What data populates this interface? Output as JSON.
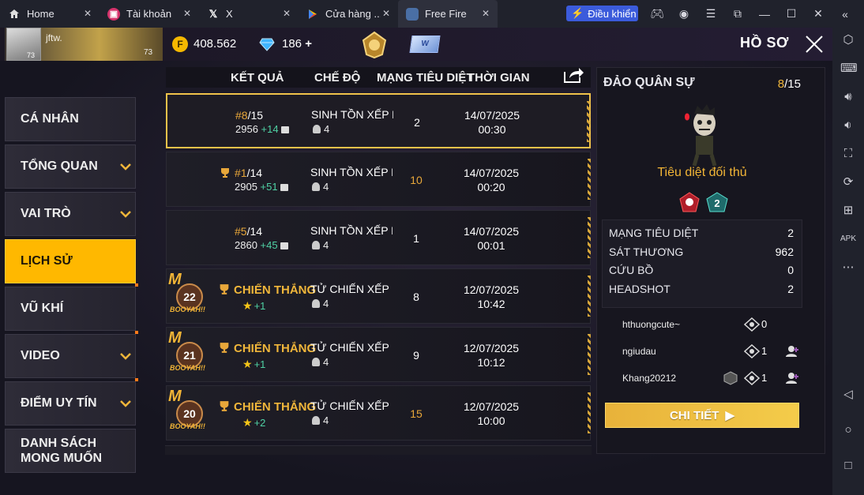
{
  "tabs": [
    {
      "label": "Home",
      "icon": "home-icon"
    },
    {
      "label": "Tài khoản",
      "icon": "app-icon"
    },
    {
      "label": "X",
      "icon": "x-logo-icon"
    },
    {
      "label": "Cửa hàng ...",
      "icon": "play-store-icon"
    },
    {
      "label": "Free Fire",
      "icon": "free-fire-icon"
    }
  ],
  "control_button": "Điều khiển",
  "topbar": {
    "player_name": "jftw.",
    "level_small": "73",
    "level": "73",
    "coins": "408.562",
    "coin_symbol": "F",
    "diamonds": "186",
    "diamonds_plus": "+",
    "card_label": "W",
    "title": "HỒ SƠ"
  },
  "menu": [
    {
      "label": "CÁ NHÂN",
      "chevron": false,
      "active": false
    },
    {
      "label": "TỔNG QUAN",
      "chevron": true,
      "active": false
    },
    {
      "label": "VAI TRÒ",
      "chevron": true,
      "active": false
    },
    {
      "label": "LỊCH SỬ",
      "chevron": false,
      "active": true
    },
    {
      "label": "VŨ KHÍ",
      "chevron": false,
      "active": false
    },
    {
      "label": "VIDEO",
      "chevron": true,
      "active": false
    },
    {
      "label": "ĐIỂM UY TÍN",
      "chevron": true,
      "active": false
    },
    {
      "label": "DANH SÁCH\nMONG MUỐN",
      "chevron": false,
      "active": false
    }
  ],
  "table": {
    "headers": {
      "result": "KẾT QUẢ",
      "mode": "CHẾ ĐỘ",
      "kills": "MẠNG TIÊU DIỆT",
      "time": "THỜI GIAN"
    },
    "rows": [
      {
        "rank": "#8",
        "total": "/15",
        "points": "2956",
        "gain": "+14",
        "mode": "SINH TỒN XẾP HẠ",
        "party": "4",
        "kills": "2",
        "date": "14/07/2025",
        "time": "00:30"
      },
      {
        "rank": "#1",
        "total": "/14",
        "points": "2905",
        "gain": "+51",
        "mode": "SINH TỒN XẾP HẠ",
        "party": "4",
        "kills": "10",
        "date": "14/07/2025",
        "time": "00:20"
      },
      {
        "rank": "#5",
        "total": "/14",
        "points": "2860",
        "gain": "+45",
        "mode": "SINH TỒN XẾP HẠ",
        "party": "4",
        "kills": "1",
        "date": "14/07/2025",
        "time": "00:01"
      },
      {
        "booyah": "22",
        "booyah_m": "M",
        "booyah_text": "BOOYAH!!",
        "win": "CHIẾN THẮNG",
        "stars": "+1",
        "mode": "TỬ CHIẾN XẾP HẠ",
        "party": "4",
        "kills": "8",
        "date": "12/07/2025",
        "time": "10:42"
      },
      {
        "booyah": "21",
        "booyah_m": "M",
        "booyah_text": "BOOYAH!!",
        "win": "CHIẾN THẮNG",
        "stars": "+1",
        "mode": "TỬ CHIẾN XẾP HẠ",
        "party": "4",
        "kills": "9",
        "date": "12/07/2025",
        "time": "10:12"
      },
      {
        "booyah": "20",
        "booyah_m": "M",
        "booyah_text": "BOOYAH!!",
        "win": "CHIẾN THẮNG",
        "stars": "+2",
        "mode": "TỬ CHIẾN XẾP HẠ",
        "party": "4",
        "kills": "15",
        "date": "12/07/2025",
        "time": "10:00"
      }
    ]
  },
  "panel": {
    "map": "ĐẢO QUÂN SỰ",
    "place": "8",
    "total": "/15",
    "subtitle": "Tiêu diệt đối thủ",
    "badge_value": "2",
    "stats": [
      {
        "label": "MẠNG TIÊU DIỆT",
        "value": "2"
      },
      {
        "label": "SÁT THƯƠNG",
        "value": "962"
      },
      {
        "label": "CỨU BỒ",
        "value": "0"
      },
      {
        "label": "HEADSHOT",
        "value": "2"
      }
    ],
    "players": [
      {
        "name": "hthuongcute~",
        "kills": "0"
      },
      {
        "name": "ngiudau",
        "kills": "1"
      },
      {
        "name": "Khang20212",
        "kills": "1"
      }
    ],
    "detail_button": "CHI TIẾT"
  },
  "colors": {
    "accent": "#ffb800",
    "gold_text": "#f0b63a",
    "gain": "#4fd1a4",
    "tab_bar": "#20222c"
  }
}
